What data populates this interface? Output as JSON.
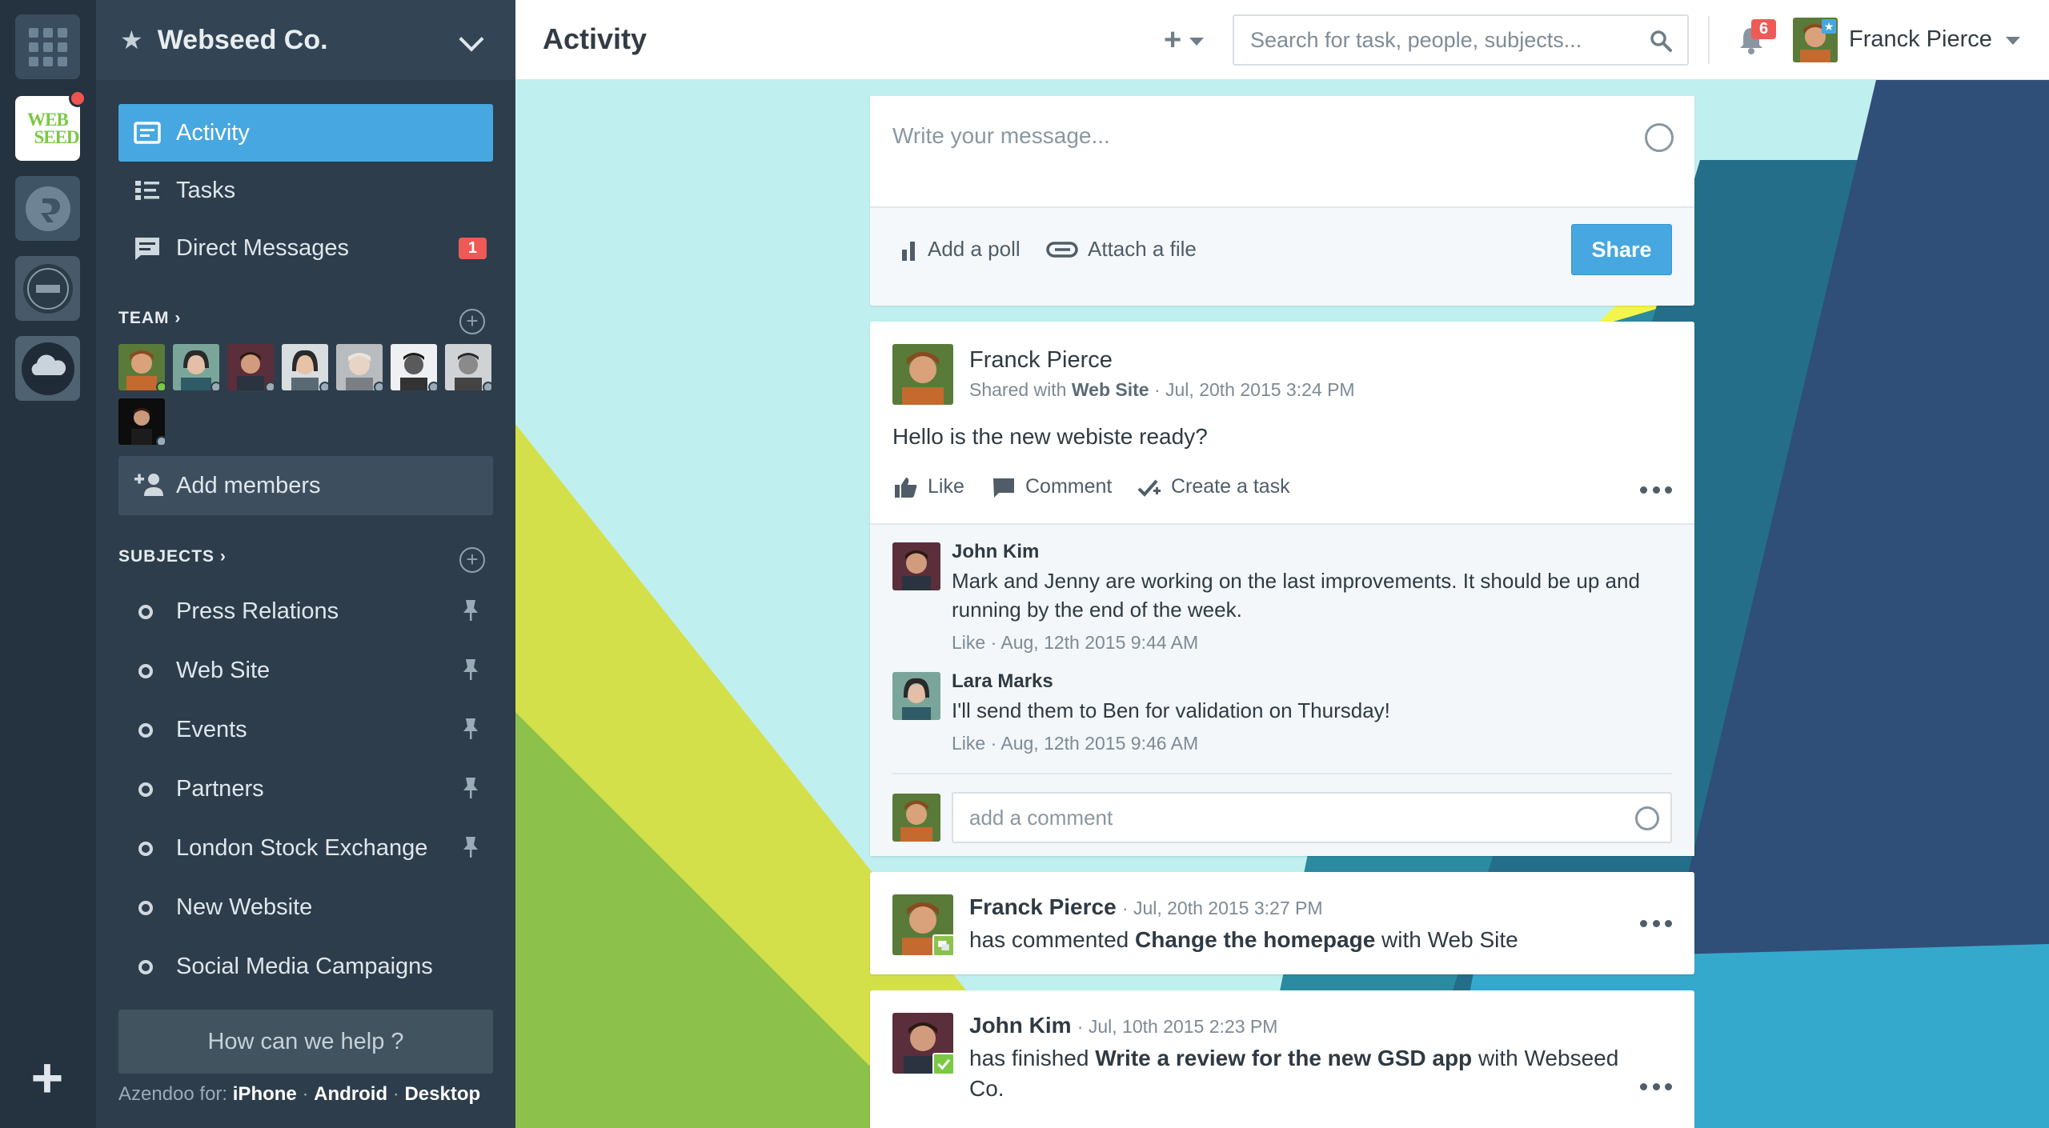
{
  "org": {
    "name": "Webseed Co."
  },
  "rail": {
    "webseed_line1": "WEB",
    "webseed_line2": "SEED"
  },
  "nav": [
    {
      "label": "Activity"
    },
    {
      "label": "Tasks"
    },
    {
      "label": "Direct Messages",
      "badge": "1"
    }
  ],
  "team": {
    "label": "TEAM",
    "add_members": "Add members"
  },
  "subjects": {
    "label": "SUBJECTS",
    "items": [
      {
        "label": "Press Relations"
      },
      {
        "label": "Web Site"
      },
      {
        "label": "Events"
      },
      {
        "label": "Partners"
      },
      {
        "label": "London Stock Exchange"
      },
      {
        "label": "New Website"
      },
      {
        "label": "Social Media Campaigns"
      }
    ]
  },
  "help": {
    "label": "How can we help ?"
  },
  "footer": {
    "prefix": "Azendoo for:",
    "iphone": "iPhone",
    "android": "Android",
    "desktop": "Desktop",
    "sep": "·"
  },
  "topbar": {
    "title": "Activity",
    "search_placeholder": "Search for task, people, subjects...",
    "notifications": "6",
    "user_name": "Franck Pierce"
  },
  "composer": {
    "placeholder": "Write your message...",
    "add_poll": "Add a poll",
    "attach_file": "Attach a file",
    "share": "Share"
  },
  "post": {
    "author": "Franck Pierce",
    "shared_prefix": "Shared with",
    "shared_with": "Web Site",
    "time": "· Jul, 20th 2015 3:24 PM",
    "text": "Hello is the new webiste ready?",
    "like": "Like",
    "comment": "Comment",
    "create_task": "Create a task",
    "comments": [
      {
        "author": "John Kim",
        "text": "Mark and Jenny are working on the last improvements. It should be up and running by the end of the week.",
        "meta": "Like · Aug, 12th 2015 9:44 AM"
      },
      {
        "author": "Lara Marks",
        "text": "I'll send them to Ben for validation on Thursday!",
        "meta": "Like · Aug, 12th 2015 9:46 AM"
      }
    ],
    "comment_placeholder": "add a comment"
  },
  "notifications": [
    {
      "author": "Franck Pierce",
      "time": "· Jul, 20th 2015 3:27 PM",
      "action": "has commented",
      "target": "Change the homepage",
      "with": "with Web Site"
    },
    {
      "author": "John Kim",
      "time": "· Jul, 10th 2015 2:23 PM",
      "action": "has finished",
      "target": "Write a review for the new GSD app",
      "with": "with Webseed Co."
    }
  ],
  "colors": {
    "accent": "#47a7e0",
    "badge": "#ee5a55",
    "online": "#7ac943"
  }
}
